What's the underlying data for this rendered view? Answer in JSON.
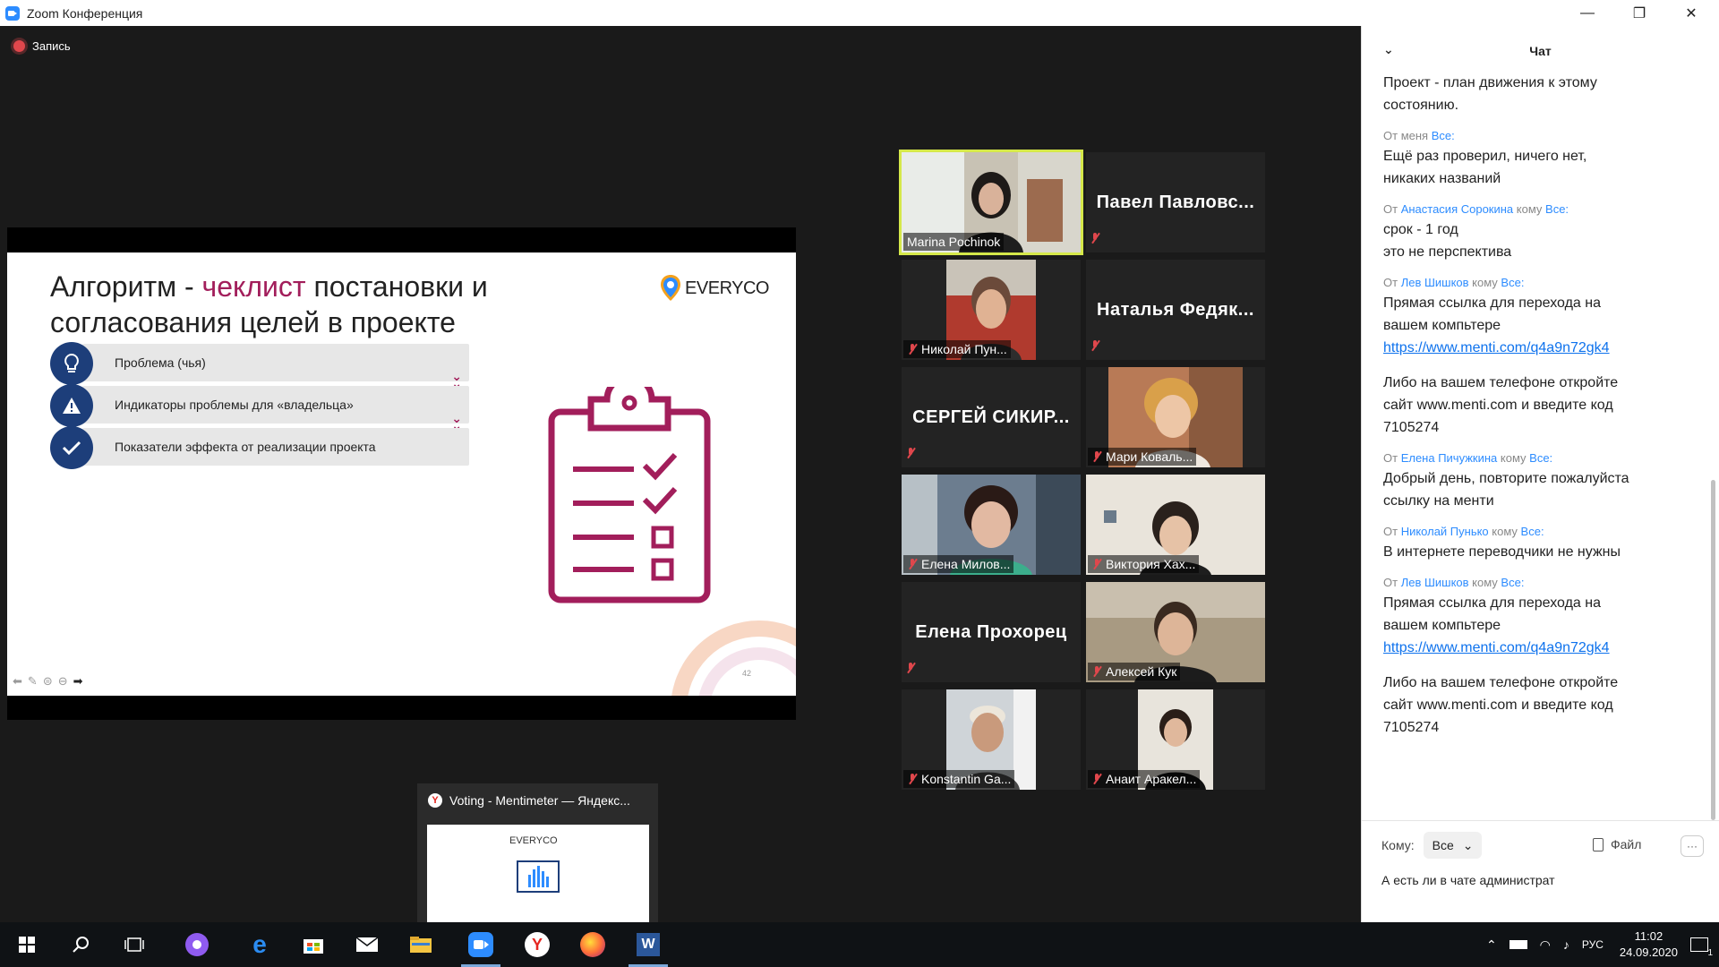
{
  "window": {
    "title": "Zoom Конференция",
    "minimize": "—",
    "maximize": "❐",
    "close": "✕"
  },
  "recording": {
    "label": "Запись"
  },
  "slide": {
    "title_part1": "Алгоритм - ",
    "title_accent": "чеклист",
    "title_part2": " постановки и согласования целей в проекте",
    "logo_text": "EVERYCO",
    "items": [
      {
        "label": "Проблема (чья)",
        "icon": "lightbulb-icon"
      },
      {
        "label": "Индикаторы проблемы для «владельца»",
        "icon": "warning-icon"
      },
      {
        "label": "Показатели эффекта от реализации проекта",
        "icon": "check-icon"
      }
    ],
    "page_number": "42",
    "accent_color": "#a21e5b",
    "primary_color": "#1d3e7a"
  },
  "participants": [
    {
      "name": "Marina Pochinok",
      "video": true,
      "muted": false,
      "active": true
    },
    {
      "name": "Павел Павловс...",
      "video": false,
      "muted": true
    },
    {
      "name": "Николай Пун...",
      "video": true,
      "muted": true
    },
    {
      "name": "Наталья Федяк...",
      "video": false,
      "muted": true
    },
    {
      "name": "СЕРГЕЙ СИКИР...",
      "video": false,
      "muted": true
    },
    {
      "name": "Мари Коваль...",
      "video": true,
      "muted": true
    },
    {
      "name": "Елена Милов...",
      "video": true,
      "muted": true
    },
    {
      "name": "Виктория Хах...",
      "video": true,
      "muted": true
    },
    {
      "name": "Елена Прохорец",
      "video": false,
      "muted": true
    },
    {
      "name": "Алексей Кук",
      "video": true,
      "muted": true
    },
    {
      "name": "Konstantin Ga...",
      "video": true,
      "muted": true
    },
    {
      "name": "Анаит Аракел...",
      "video": true,
      "muted": true
    }
  ],
  "mini_window": {
    "title": "Voting - Mentimeter — Яндекс...",
    "thumb_logo": "EVERYCO"
  },
  "chat": {
    "header": "Чат",
    "messages": [
      {
        "from": "",
        "to": "",
        "body": "Проект - план движения к этому\nсостоянию."
      },
      {
        "prefix": "От ",
        "from": "меня",
        "to_prefix": " ",
        "to": "Все:",
        "body": "Ещё раз проверил, ничего нет,\nникаких названий"
      },
      {
        "prefix": "От ",
        "from": "Анастасия Сорокина",
        "to_prefix": " кому ",
        "to": "Все:",
        "body": "срок - 1 год\nэто не перспектива"
      },
      {
        "prefix": "От ",
        "from": "Лев Шишков",
        "to_prefix": " кому ",
        "to": "Все:",
        "body": "Прямая ссылка для перехода на\nвашем компьтере",
        "link": "https://www.menti.com/q4a9n72gk4",
        "after": "Либо на вашем телефоне откройте\nсайт www.menti.com и введите код\n7105274"
      },
      {
        "prefix": "От ",
        "from": "Елена Пичужкина",
        "to_prefix": " кому ",
        "to": "Все:",
        "body": "Добрый день, повторите пожалуйста\nссылку на менти"
      },
      {
        "prefix": "От ",
        "from": "Николай Пунько",
        "to_prefix": " кому ",
        "to": "Все:",
        "body": "В интернете переводчики не нужны"
      },
      {
        "prefix": "От ",
        "from": "Лев Шишков",
        "to_prefix": " кому ",
        "to": "Все:",
        "body": "Прямая ссылка для перехода на\nвашем компьтере",
        "link": "https://www.menti.com/q4a9n72gk4",
        "after": "Либо на вашем телефоне откройте\nсайт www.menti.com и введите код\n7105274"
      }
    ],
    "to_label": "Кому:",
    "to_value": "Все",
    "file_label": "Файл",
    "more_label": "···",
    "input_value": "А есть ли в чате администрат"
  },
  "taskbar": {
    "icons": [
      "windows-start-icon",
      "search-icon",
      "task-view-icon",
      "alice-icon",
      "edge-icon",
      "store-icon",
      "mail-icon",
      "explorer-icon",
      "zoom-icon",
      "yandex-browser-icon",
      "firefox-icon",
      "word-icon"
    ],
    "language": "РУС",
    "time": "11:02",
    "date": "24.09.2020",
    "notification_count": "1"
  }
}
